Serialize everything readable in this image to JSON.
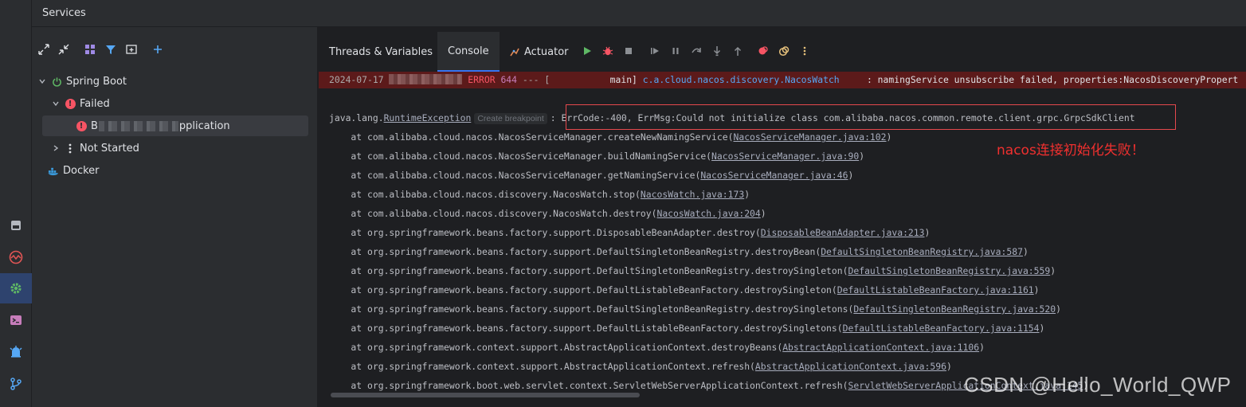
{
  "header": {
    "title": "Services"
  },
  "toolstrip": {
    "items": [
      {
        "icon": "database-icon"
      },
      {
        "icon": "profiler-icon"
      },
      {
        "icon": "services-gear-icon",
        "active": true
      },
      {
        "icon": "terminal-icon"
      },
      {
        "icon": "notifications-icon"
      },
      {
        "icon": "git-branch-icon"
      }
    ]
  },
  "tree_toolbar": {
    "icons": [
      "expand-all-icon",
      "collapse-all-icon",
      "group-by-icon",
      "filter-icon",
      "new-tab-icon",
      "add-service-icon"
    ]
  },
  "tree": {
    "spring_boot": "Spring Boot",
    "failed": "Failed",
    "app_prefix": "B",
    "app_suffix": "pplication",
    "not_started": "Not Started",
    "docker": "Docker"
  },
  "tabs": {
    "threads": "Threads & Variables",
    "console": "Console",
    "actuator": "Actuator"
  },
  "colors": {
    "accent": "#3574f0",
    "error": "#f75464",
    "run_green": "#5fb865",
    "annotation_red": "#f0302f"
  },
  "error_line": {
    "date": "2024-07-17",
    "level": "ERROR",
    "pid": "644",
    "sep": "--- [",
    "thread": "           main]",
    "logger": "c.a.cloud.nacos.discovery.NacosWatch",
    "message": "     : namingService unsubscribe failed, properties:NacosDiscoveryPropert"
  },
  "exception": {
    "prefix": "java.lang.",
    "class_link": "RuntimeException",
    "breakpoint_hint": "Create breakpoint",
    "colon": ":",
    "detail": "ErrCode:-400, ErrMsg:Could not initialize class com.alibaba.nacos.common.remote.client.grpc.GrpcSdkClient"
  },
  "stack": [
    {
      "text": "    at com.alibaba.cloud.nacos.NacosServiceManager.createNewNamingService(",
      "link": "NacosServiceManager.java:102",
      "end": ")"
    },
    {
      "text": "    at com.alibaba.cloud.nacos.NacosServiceManager.buildNamingService(",
      "link": "NacosServiceManager.java:90",
      "end": ")"
    },
    {
      "text": "    at com.alibaba.cloud.nacos.NacosServiceManager.getNamingService(",
      "link": "NacosServiceManager.java:46",
      "end": ")"
    },
    {
      "text": "    at com.alibaba.cloud.nacos.discovery.NacosWatch.stop(",
      "link": "NacosWatch.java:173",
      "end": ")"
    },
    {
      "text": "    at com.alibaba.cloud.nacos.discovery.NacosWatch.destroy(",
      "link": "NacosWatch.java:204",
      "end": ")"
    },
    {
      "text": "    at org.springframework.beans.factory.support.DisposableBeanAdapter.destroy(",
      "link": "DisposableBeanAdapter.java:213",
      "end": ")"
    },
    {
      "text": "    at org.springframework.beans.factory.support.DefaultSingletonBeanRegistry.destroyBean(",
      "link": "DefaultSingletonBeanRegistry.java:587",
      "end": ")"
    },
    {
      "text": "    at org.springframework.beans.factory.support.DefaultSingletonBeanRegistry.destroySingleton(",
      "link": "DefaultSingletonBeanRegistry.java:559",
      "end": ")"
    },
    {
      "text": "    at org.springframework.beans.factory.support.DefaultListableBeanFactory.destroySingleton(",
      "link": "DefaultListableBeanFactory.java:1161",
      "end": ")"
    },
    {
      "text": "    at org.springframework.beans.factory.support.DefaultSingletonBeanRegistry.destroySingletons(",
      "link": "DefaultSingletonBeanRegistry.java:520",
      "end": ")"
    },
    {
      "text": "    at org.springframework.beans.factory.support.DefaultListableBeanFactory.destroySingletons(",
      "link": "DefaultListableBeanFactory.java:1154",
      "end": ")"
    },
    {
      "text": "    at org.springframework.context.support.AbstractApplicationContext.destroyBeans(",
      "link": "AbstractApplicationContext.java:1106",
      "end": ")"
    },
    {
      "text": "    at org.springframework.context.support.AbstractApplicationContext.refresh(",
      "link": "AbstractApplicationContext.java:596",
      "end": ")"
    },
    {
      "text": "    at org.springframework.boot.web.servlet.context.ServletWebServerApplicationContext.refresh(",
      "link": "ServletWebServerApplicationContext.java:145",
      "end": ")"
    }
  ],
  "annotation": "nacos连接初始化失败！",
  "watermark": "CSDN @Hello_World_QWP"
}
